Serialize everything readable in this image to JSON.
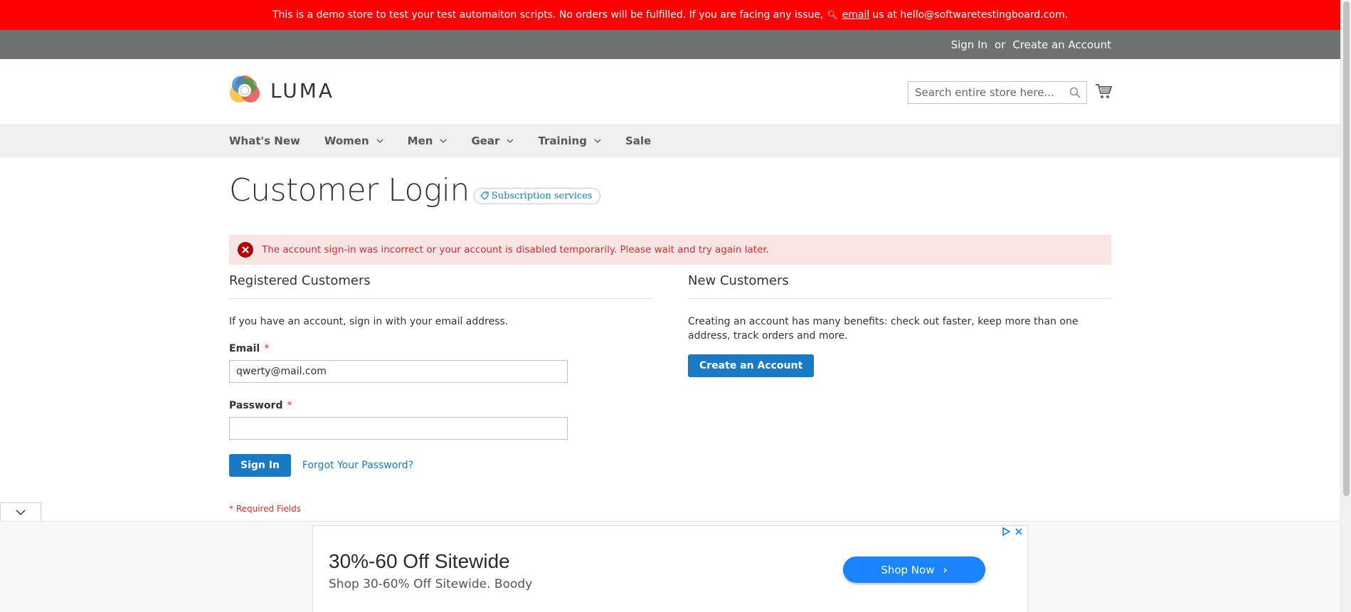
{
  "demo_banner": {
    "text": "This is a demo store to test your test automaiton scripts. No orders will be fulfilled. If you are facing any issue,",
    "email_link": "email",
    "text_after": "us at hello@softwaretestingboard.com."
  },
  "top_links": {
    "sign_in": "Sign In",
    "or": "or",
    "create_account": "Create an Account"
  },
  "header": {
    "logo_text": "LUMA",
    "search_placeholder": "Search entire store here..."
  },
  "nav": {
    "items": [
      {
        "label": "What's New",
        "has_menu": false
      },
      {
        "label": "Women",
        "has_menu": true
      },
      {
        "label": "Men",
        "has_menu": true
      },
      {
        "label": "Gear",
        "has_menu": true
      },
      {
        "label": "Training",
        "has_menu": true
      },
      {
        "label": "Sale",
        "has_menu": false
      }
    ]
  },
  "page": {
    "title": "Customer Login",
    "subscription_badge": "Subscription services",
    "error_message": "The account sign-in was incorrect or your account is disabled temporarily. Please wait and try again later."
  },
  "registered": {
    "title": "Registered Customers",
    "intro": "If you have an account, sign in with your email address.",
    "email_label": "Email",
    "email_value": "qwerty@mail.com",
    "password_label": "Password",
    "password_value": "",
    "required_mark": "*",
    "sign_in_button": "Sign In",
    "forgot_link": "Forgot Your Password?",
    "required_note": "* Required Fields"
  },
  "new_customers": {
    "title": "New Customers",
    "text": "Creating an account has many benefits: check out faster, keep more than one address, track orders and more.",
    "create_button": "Create an Account"
  },
  "ad": {
    "title": "30%-60 Off Sitewide",
    "text": "Shop 30-60% Off Sitewide. Boody",
    "button": "Shop Now"
  },
  "colors": {
    "banner": "#ff0000",
    "top_links_bar": "#6e716e",
    "primary": "#1979c3",
    "error_bg": "#fae5e5",
    "error_text": "#e02b27",
    "ad_button": "#1a84ff"
  }
}
